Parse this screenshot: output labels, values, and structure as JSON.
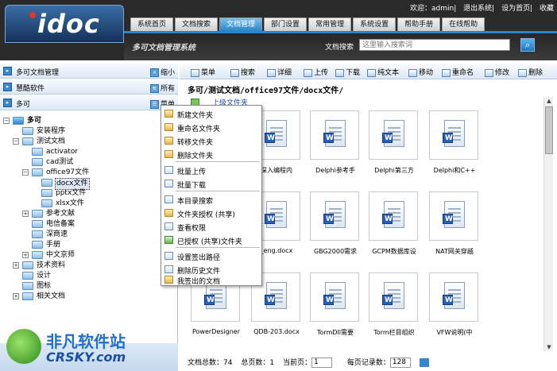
{
  "header": {
    "logo": "idoc",
    "top_links": [
      "欢迎：admin",
      "退出系统",
      "设为首页",
      "收藏"
    ],
    "nav": [
      "系统首页",
      "文档搜索",
      "文档管理",
      "部门设置",
      "常用管理",
      "系统设置",
      "帮助手册",
      "在线帮助"
    ],
    "active_nav": "文档管理",
    "system_title": "多可文档管理系统",
    "search_label": "文档搜索",
    "search_placeholder": "这里输入搜索词"
  },
  "left": {
    "panel_title": "多可文档管理",
    "panel_action": "缩小",
    "company_label": "慧酷软件",
    "company_action": "所有",
    "group_label": "多可",
    "group_action": "菜单",
    "tree": [
      "多可",
      "安装程序",
      "测试文档",
      "activator",
      "cad测试",
      "office97文件",
      "docx文件",
      "pptx文件",
      "xlsx文件",
      "参考文献",
      "电信备案",
      "深商速",
      "手册",
      "中文京师",
      "技术资料",
      "设计",
      "图标",
      "相关文档"
    ]
  },
  "context_menu": {
    "items": [
      "新建文件夹",
      "重命名文件夹",
      "转移文件夹",
      "删除文件夹",
      "批量上传",
      "批量下载",
      "本目录搜索",
      "文件夹授权 (共享)",
      "查看权限",
      "已授权 (共享)文件夹",
      "设置签出路径",
      "删除历史文件",
      "我签出的文档"
    ]
  },
  "toolbar": [
    "菜单",
    "搜索",
    "详细",
    "上传",
    "下载",
    "纯文本",
    "移动",
    "重命名",
    "修改",
    "删除"
  ],
  "path": "多可/测试文档/office97文件/docx文件/",
  "up_label": "上级文件夹",
  "files": [
    "",
    "深入编程内",
    "Delphi参考手",
    "Delphi第三方",
    "Delphi和C++",
    "",
    "_eng.docx",
    "GBG2000需求",
    "GCPM数据库设",
    "NAT网关穿越",
    "PowerDesigner",
    "QDB-203.docx",
    "TormDll需要",
    "Torm栏目组织",
    "VFW说明(中"
  ],
  "status": {
    "total": "文档总数：74",
    "pages": "总页数：1",
    "current_label": "当前页：",
    "current": "1",
    "per_page_label": "每页记录数：",
    "per_page": "128"
  },
  "watermark": {
    "cn": "非凡软件站",
    "en": "CRSKY.com"
  }
}
